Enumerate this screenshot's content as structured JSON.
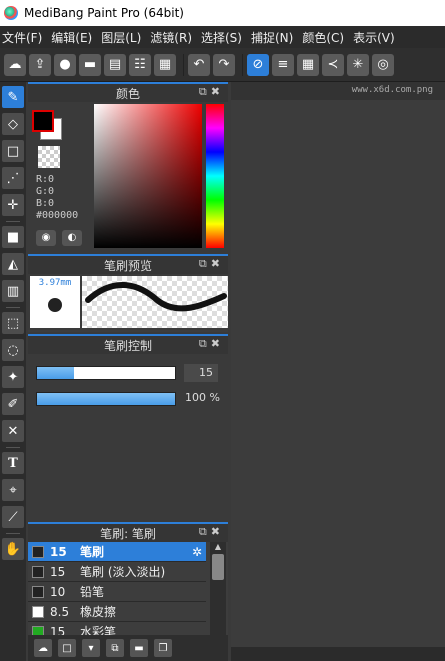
{
  "window": {
    "title": "MediBang Paint Pro (64bit)"
  },
  "menu": [
    "文件(F)",
    "编辑(E)",
    "图层(L)",
    "滤镜(R)",
    "选择(S)",
    "捕捉(N)",
    "颜色(C)",
    "表示(V)"
  ],
  "toolbar_icons": [
    "cloud-icon",
    "upload-icon",
    "chat-icon",
    "comment-icon",
    "document-icon",
    "grid-panel-icon",
    "tile-icon",
    "undo-icon",
    "redo-icon",
    "snap-off-icon",
    "parallel-snap-icon",
    "grid-snap-icon",
    "radial-snap-icon",
    "burst-snap-icon",
    "concentric-snap-icon"
  ],
  "left_tools": [
    "brush-icon",
    "eraser-icon",
    "rectangle-icon",
    "dot-line-icon",
    "move-icon",
    "fill-rect-icon",
    "bucket-icon",
    "gradient-icon",
    "select-rect-icon",
    "lasso-icon",
    "magic-wand-icon",
    "select-pen-icon",
    "select-eraser-icon",
    "text-icon",
    "operation-icon",
    "eyedropper-icon",
    "hand-icon"
  ],
  "color_panel": {
    "title": "颜色",
    "r_label": "R:0",
    "g_label": "G:0",
    "b_label": "B:0",
    "hex": "#000000",
    "current_color": "#000000",
    "secondary_color": "#ffffff"
  },
  "brush_preview_panel": {
    "title": "笔刷预览",
    "size_label": "3.97mm"
  },
  "brush_control_panel": {
    "title": "笔刷控制",
    "size_value": "15",
    "opacity_value": "100 %",
    "size_fraction": 0.27,
    "opacity_fraction": 1.0
  },
  "brush_list_panel": {
    "title": "笔刷: 笔刷",
    "items": [
      {
        "size": "15",
        "name": "笔刷",
        "color": "#222222",
        "selected": true
      },
      {
        "size": "15",
        "name": "笔刷 (淡入淡出)",
        "color": "#222222",
        "selected": false
      },
      {
        "size": "10",
        "name": "铅笔",
        "color": "#222222",
        "selected": false
      },
      {
        "size": "8.5",
        "name": "橡皮擦",
        "color": "#ffffff",
        "selected": false
      },
      {
        "size": "15",
        "name": "水彩笔",
        "color": "#22aa22",
        "selected": false
      }
    ]
  },
  "canvas": {
    "watermark": "www.x6d.com.png"
  },
  "accent_color": "#2d7fd9"
}
